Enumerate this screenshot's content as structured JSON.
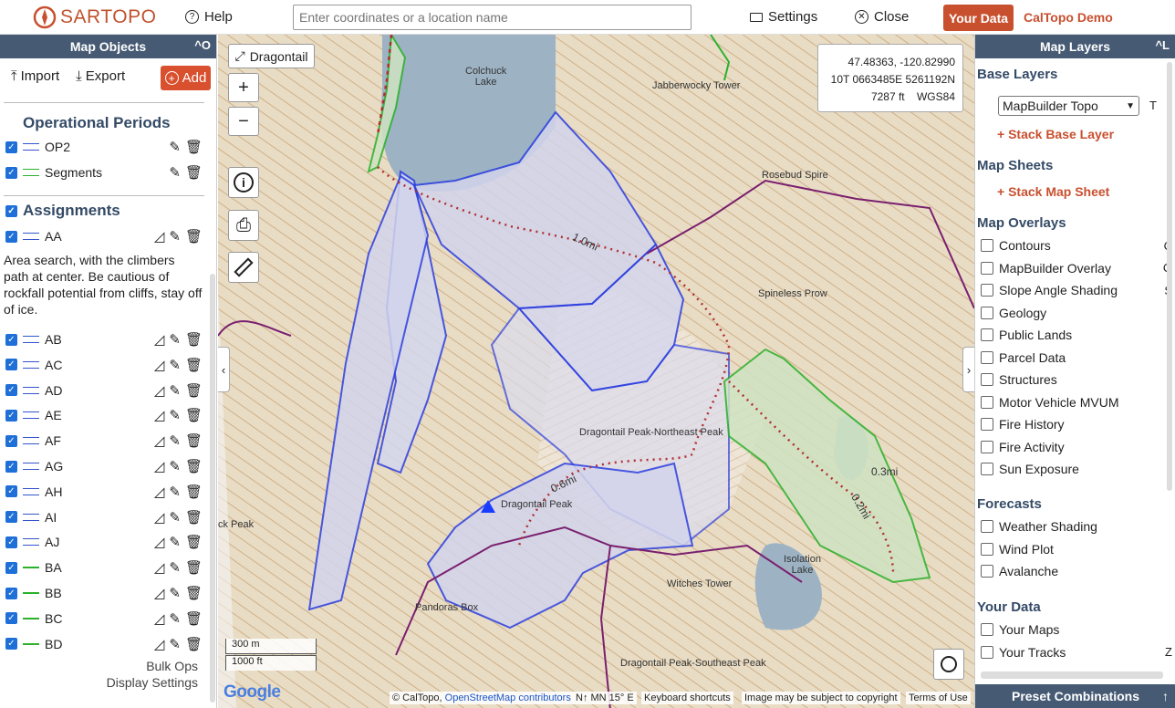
{
  "topbar": {
    "logo_a": "SAR",
    "logo_b": "TOPO",
    "help": "Help",
    "search_placeholder": "Enter coordinates or a location name",
    "settings": "Settings",
    "close": "Close",
    "your_data": "Your Data",
    "demo": "CalTopo Demo"
  },
  "left": {
    "title": "Map Objects",
    "title_ctl": "^O",
    "import": "Import",
    "export": "Export",
    "add": "Add",
    "op_periods": "Operational Periods",
    "op_items": [
      {
        "label": "OP2"
      },
      {
        "label": "Segments"
      }
    ],
    "assignments": "Assignments",
    "aa": {
      "label": "AA",
      "desc": "Area search, with the climbers path at center. Be cautious of rockfall potential from cliffs, stay off of ice."
    },
    "items": [
      {
        "label": "AB"
      },
      {
        "label": "AC"
      },
      {
        "label": "AD"
      },
      {
        "label": "AE"
      },
      {
        "label": "AF"
      },
      {
        "label": "AG"
      },
      {
        "label": "AH"
      },
      {
        "label": "AI"
      },
      {
        "label": "AJ"
      },
      {
        "label": "BA"
      },
      {
        "label": "BB"
      },
      {
        "label": "BC"
      },
      {
        "label": "BD"
      }
    ],
    "bulk_ops": "Bulk Ops",
    "display_settings": "Display Settings"
  },
  "map": {
    "dragontail_btn": "Dragontail",
    "coord1": "47.48363, -120.82990",
    "coord2": "10T 0663485E 5261192N",
    "coord3_alt": "7287 ft",
    "coord3_datum": "WGS84",
    "scale_m": "300 m",
    "scale_ft": "1000 ft",
    "labels": {
      "colchuck": "Colchuck\nLake",
      "jabberwocky": "Jabberwocky Tower",
      "rosebud": "Rosebud Spire",
      "spineless": "Spineless Prow",
      "dragontail_ne": "Dragontail Peak-Northeast Peak",
      "dragontail": "Dragontail Peak",
      "isolation": "Isolation\nLake",
      "witches": "Witches Tower",
      "pandoras": "Pandoras Box",
      "dragontail_se": "Dragontail Peak-Southeast Peak",
      "ckpeak": "ck Peak",
      "dist1": "1.0mi",
      "dist2": "0.6mi",
      "dist3": "0.3mi",
      "dist4": "0.2mi"
    },
    "footer": {
      "copy": "© CalTopo, ",
      "osm": "OpenStreetMap contributors",
      "mn": "N↑ MN 15° E",
      "shortcuts": "Keyboard shortcuts",
      "subject": "Image may be subject to copyright",
      "terms": "Terms of Use",
      "google": "Google"
    }
  },
  "right": {
    "title": "Map Layers",
    "title_ctl": "^L",
    "base_layers": "Base Layers",
    "base_select": "MapBuilder Topo",
    "base_key": "T",
    "stack_base": "+ Stack Base Layer",
    "map_sheets": "Map Sheets",
    "stack_sheet": "+ Stack Map Sheet",
    "overlays": "Map Overlays",
    "overlay_items": [
      {
        "label": "Contours",
        "key": "C"
      },
      {
        "label": "MapBuilder Overlay",
        "key": "O"
      },
      {
        "label": "Slope Angle Shading",
        "key": "S"
      },
      {
        "label": "Geology",
        "key": ""
      },
      {
        "label": "Public Lands",
        "key": ""
      },
      {
        "label": "Parcel Data",
        "key": ""
      },
      {
        "label": "Structures",
        "key": ""
      },
      {
        "label": "Motor Vehicle MVUM",
        "key": ""
      },
      {
        "label": "Fire History",
        "key": ""
      },
      {
        "label": "Fire Activity",
        "key": ""
      },
      {
        "label": "Sun Exposure",
        "key": ""
      }
    ],
    "forecasts": "Forecasts",
    "forecast_items": [
      {
        "label": "Weather Shading"
      },
      {
        "label": "Wind Plot"
      },
      {
        "label": "Avalanche"
      }
    ],
    "your_data": "Your Data",
    "data_items": [
      {
        "label": "Your Maps",
        "key": ""
      },
      {
        "label": "Your Tracks",
        "key": "Z"
      }
    ],
    "preset": "Preset Combinations"
  },
  "colors": {
    "accent": "#c8502f",
    "header": "#465a74",
    "assign_line": "#2d3fe0",
    "segment_line": "#2bb12b",
    "boundary": "#7a1f6e"
  }
}
